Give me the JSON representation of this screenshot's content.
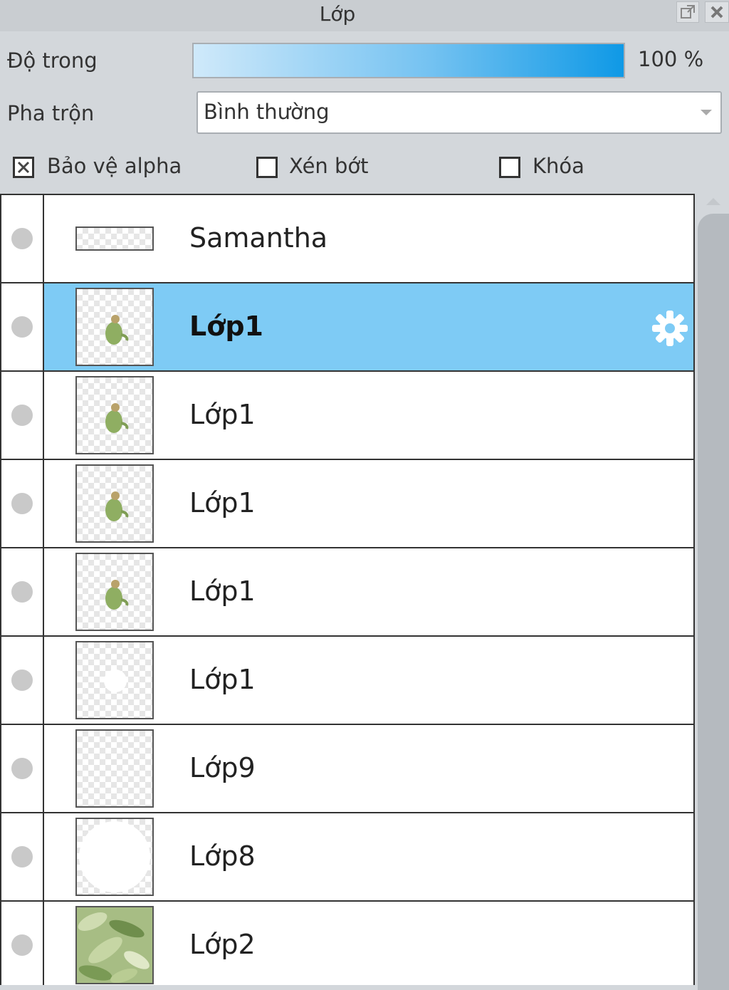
{
  "panel": {
    "title": "Lớp"
  },
  "titlebar": {
    "undock_icon": "undock-icon",
    "close_icon": "close-icon"
  },
  "opacity": {
    "label": "Độ trong",
    "value_text": "100 %",
    "value_percent": 100
  },
  "blend": {
    "label": "Pha trộn",
    "value": "Bình thường"
  },
  "options": {
    "protect_alpha": {
      "label": "Bảo vệ alpha",
      "checked": true
    },
    "clip": {
      "label": "Xén bớt",
      "checked": false
    },
    "lock": {
      "label": "Khóa",
      "checked": false
    }
  },
  "layers": [
    {
      "name": "Samantha",
      "selected": false,
      "thumbnail": "empty-wide"
    },
    {
      "name": "Lớp1",
      "selected": true,
      "thumbnail": "figure"
    },
    {
      "name": "Lớp1",
      "selected": false,
      "thumbnail": "figure"
    },
    {
      "name": "Lớp1",
      "selected": false,
      "thumbnail": "figure"
    },
    {
      "name": "Lớp1",
      "selected": false,
      "thumbnail": "figure"
    },
    {
      "name": "Lớp1",
      "selected": false,
      "thumbnail": "blank-dot"
    },
    {
      "name": "Lớp9",
      "selected": false,
      "thumbnail": "blank"
    },
    {
      "name": "Lớp8",
      "selected": false,
      "thumbnail": "circle"
    },
    {
      "name": "Lớp2",
      "selected": false,
      "thumbnail": "foliage"
    }
  ],
  "colors": {
    "selected_row": "#7ecbf5",
    "slider_accent": "#0f99e6",
    "panel_bg": "#d3d7db"
  }
}
